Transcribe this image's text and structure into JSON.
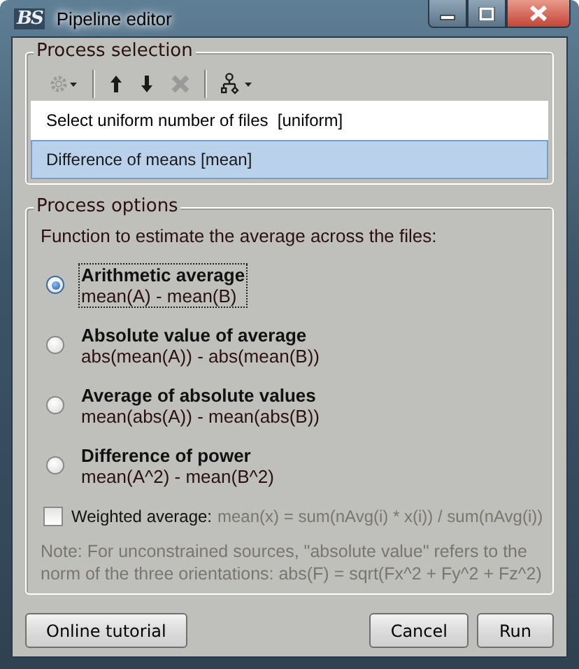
{
  "window": {
    "logo": "BS",
    "title": "Pipeline editor"
  },
  "process_selection": {
    "title": "Process selection",
    "toolbar": [
      {
        "kind": "gear",
        "disabled": true
      },
      {
        "kind": "separator"
      },
      {
        "kind": "up",
        "disabled": false
      },
      {
        "kind": "down",
        "disabled": false
      },
      {
        "kind": "delete",
        "disabled": true
      },
      {
        "kind": "separator"
      },
      {
        "kind": "tree",
        "disabled": false
      }
    ],
    "processes": [
      {
        "label": "Select uniform number of files  [uniform]",
        "selected": false
      },
      {
        "label": "Difference of means [mean]",
        "selected": true
      }
    ]
  },
  "process_options": {
    "title": "Process options",
    "prompt": "Function to estimate the average across the files:",
    "options": [
      {
        "label": "Arithmetic average",
        "formula": "mean(A) - mean(B)",
        "selected": true
      },
      {
        "label": "Absolute value of average",
        "formula": "abs(mean(A)) - abs(mean(B))",
        "selected": false
      },
      {
        "label": "Average of absolute values",
        "formula": "mean(abs(A)) - mean(abs(B))",
        "selected": false
      },
      {
        "label": "Difference of power",
        "formula": "mean(A^2) - mean(B^2)",
        "selected": false
      }
    ],
    "weighted": {
      "label": "Weighted average:",
      "formula": "mean(x) = sum(nAvg(i) * x(i)) / sum(nAvg(i))",
      "checked": false
    },
    "note": "Note: For unconstrained sources, \"absolute value\" refers to the norm of the three orientations: abs(F) = sqrt(Fx^2 + Fy^2 + Fz^2)"
  },
  "buttons": [
    {
      "label": "Online tutorial"
    },
    {
      "label": "Cancel"
    },
    {
      "label": "Run"
    }
  ]
}
